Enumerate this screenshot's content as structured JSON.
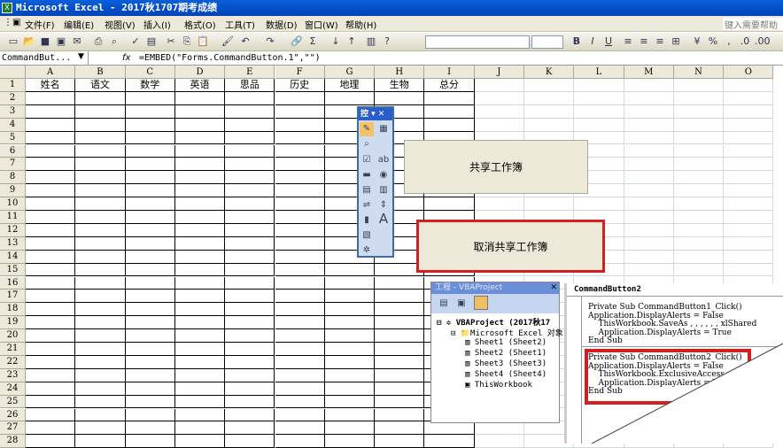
{
  "window": {
    "title": "Microsoft Excel - 2017秋1707期考成绩"
  },
  "menu": [
    "文件(F)",
    "编辑(E)",
    "视图(V)",
    "插入(I)",
    "格式(O)",
    "工具(T)",
    "数据(D)",
    "窗口(W)",
    "帮助(H)"
  ],
  "help_placeholder": "键入需要帮助的",
  "formula_bar": {
    "name_box": "CommandBut...",
    "fx": "fx",
    "formula": "=EMBED(\"Forms.CommandButton.1\",\"\")"
  },
  "columns": [
    "A",
    "B",
    "C",
    "D",
    "E",
    "F",
    "G",
    "H",
    "I",
    "J",
    "K",
    "L",
    "M",
    "N",
    "O"
  ],
  "rows": [
    "1",
    "2",
    "3",
    "4",
    "5",
    "6",
    "7",
    "8",
    "9",
    "10",
    "11",
    "12",
    "13",
    "14",
    "15",
    "16",
    "17",
    "18",
    "19",
    "20",
    "21",
    "22",
    "23",
    "24",
    "25",
    "26",
    "27",
    "28"
  ],
  "headers": [
    "姓名",
    "语文",
    "数学",
    "英语",
    "思品",
    "历史",
    "地理",
    "生物",
    "总分"
  ],
  "buttons": {
    "share": "共享工作簿",
    "unshare": "取消共享工作簿"
  },
  "toolbox": {
    "title": "控"
  },
  "project": {
    "title": "工程 - VBAProject",
    "root": "VBAProject (2017秋17",
    "folder": "Microsoft Excel 对象",
    "items": [
      "Sheet1 (Sheet2)",
      "Sheet2 (Sheet1)",
      "Sheet3 (Sheet3)",
      "Sheet4 (Sheet4)",
      "ThisWorkbook"
    ]
  },
  "code": {
    "object": "CommandButton2",
    "lines1": [
      "Private Sub CommandButton1_Click()",
      "Application.DisplayAlerts = False",
      "    ThisWorkbook.SaveAs , , , , , , xlShared",
      "    Application.DisplayAlerts = True",
      "End Sub"
    ],
    "lines2": [
      "Private Sub CommandButton2_Click()",
      "Application.DisplayAlerts = False",
      "    ThisWorkbook.ExclusiveAccess",
      "    Application.DisplayAlerts = True",
      "End Sub"
    ]
  },
  "colors": {
    "highlight": "#d21f1f",
    "title": "#0a5fd8"
  }
}
